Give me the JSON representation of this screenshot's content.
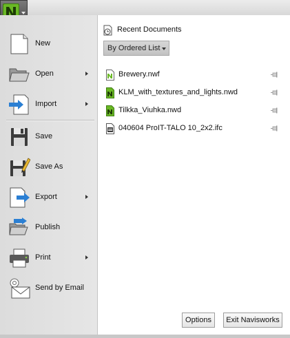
{
  "app_menu": {
    "logo_letter": "N",
    "accent_color": "#6ab825"
  },
  "menu": {
    "items": [
      {
        "label": "New",
        "icon": "new-document-icon",
        "submenu": false
      },
      {
        "label": "Open",
        "icon": "folder-open-icon",
        "submenu": true
      },
      {
        "label": "Import",
        "icon": "import-icon",
        "submenu": true
      },
      {
        "label": "Save",
        "icon": "floppy-disk-icon",
        "submenu": false
      },
      {
        "label": "Save As",
        "icon": "save-as-icon",
        "submenu": false
      },
      {
        "label": "Export",
        "icon": "export-icon",
        "submenu": true
      },
      {
        "label": "Publish",
        "icon": "publish-icon",
        "submenu": false
      },
      {
        "label": "Print",
        "icon": "printer-icon",
        "submenu": true
      },
      {
        "label": "Send by Email",
        "icon": "email-icon",
        "submenu": false
      }
    ]
  },
  "recent": {
    "header": "Recent Documents",
    "sort_label": "By Ordered List",
    "documents": [
      {
        "name": "Brewery.nwf",
        "icon": "nwf-file-icon"
      },
      {
        "name": "KLM_with_textures_and_lights.nwd",
        "icon": "nwd-file-icon"
      },
      {
        "name": "Tilkka_Viuhka.nwd",
        "icon": "nwd-file-icon"
      },
      {
        "name": "040604 ProIT-TALO 10_2x2.ifc",
        "icon": "ifc-file-icon"
      }
    ]
  },
  "footer": {
    "options_label": "Options",
    "exit_label": "Exit Navisworks"
  }
}
